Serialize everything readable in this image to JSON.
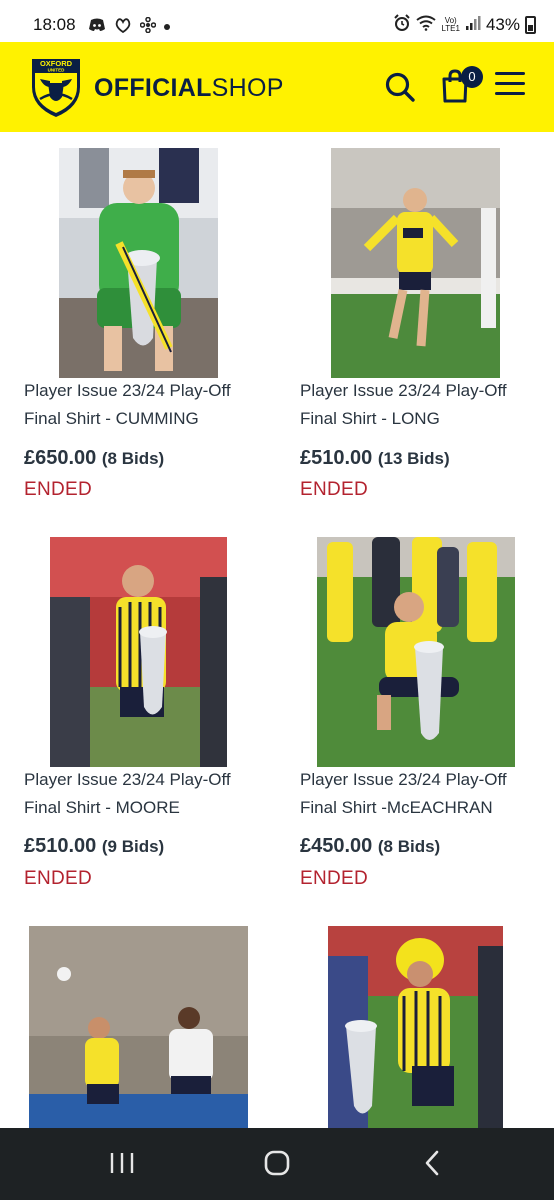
{
  "status_bar": {
    "time": "18:08",
    "network": "Vo)\nLTE1",
    "battery": "43%",
    "icons": [
      "discord-icon",
      "app-icon",
      "fan-icon",
      "dot-icon",
      "alarm-icon",
      "wifi-icon",
      "signal-icon",
      "battery-icon"
    ]
  },
  "header": {
    "crest_text": "OXFORD UNITED",
    "brand_bold": "OFFICIAL",
    "brand_light": "SHOP",
    "cart_count": "0",
    "colors": {
      "background": "#fff200",
      "navy": "#0a1f44"
    }
  },
  "products": [
    {
      "title_line1": "Player Issue 23/24 Play-Off",
      "title_line2": "Final Shirt - CUMMING",
      "price": "£650.00",
      "bids": "(8 Bids)",
      "status": "ENDED"
    },
    {
      "title_line1": "Player Issue 23/24 Play-Off",
      "title_line2": "Final Shirt - LONG",
      "price": "£510.00",
      "bids": "(13 Bids)",
      "status": "ENDED"
    },
    {
      "title_line1": "Player Issue 23/24 Play-Off",
      "title_line2": "Final Shirt - MOORE",
      "price": "£510.00",
      "bids": "(9 Bids)",
      "status": "ENDED"
    },
    {
      "title_line1": "Player Issue 23/24 Play-Off",
      "title_line2": "Final Shirt -McEACHRAN",
      "price": "£450.00",
      "bids": "(8 Bids)",
      "status": "ENDED"
    },
    {
      "title_line1": "",
      "title_line2": "",
      "price": "",
      "bids": "",
      "status": ""
    },
    {
      "title_line1": "",
      "title_line2": "",
      "price": "",
      "bids": "",
      "status": ""
    }
  ],
  "colors": {
    "ended": "#b3232f",
    "kit_yellow": "#f5e12a",
    "kit_navy": "#1a1f3a"
  },
  "nav_bar": {
    "icons": [
      "recents-icon",
      "home-icon",
      "back-icon"
    ]
  }
}
